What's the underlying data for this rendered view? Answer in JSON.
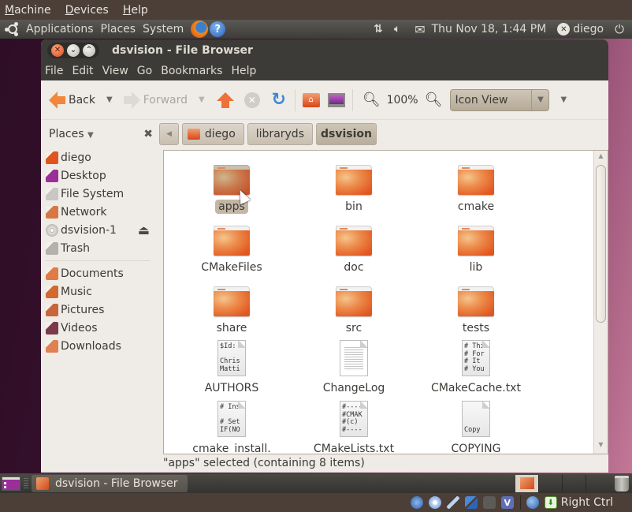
{
  "vbox_menu": {
    "items": [
      {
        "label": "Machine",
        "underline": "M",
        "rest": "achine"
      },
      {
        "label": "Devices",
        "underline": "D",
        "rest": "evices"
      },
      {
        "label": "Help",
        "underline": "H",
        "rest": "elp"
      }
    ]
  },
  "top_panel": {
    "menus": [
      "Applications",
      "Places",
      "System"
    ],
    "clock": "Thu Nov 18,  1:44 PM",
    "user": "diego"
  },
  "window": {
    "title": "dsvision - File Browser",
    "menubar": [
      "File",
      "Edit",
      "View",
      "Go",
      "Bookmarks",
      "Help"
    ],
    "toolbar": {
      "back_label": "Back",
      "forward_label": "Forward",
      "zoom_level": "100%",
      "view_mode": "Icon View"
    },
    "sidebar_header": "Places",
    "path": [
      "diego",
      "libraryds",
      "dsvision"
    ],
    "sidebar": {
      "devices": [
        {
          "label": "diego",
          "icon": "home-folder-icon",
          "color": "#e0541e"
        },
        {
          "label": "Desktop",
          "icon": "desktop-icon",
          "color": "#9a2f9a"
        },
        {
          "label": "File System",
          "icon": "harddisk-icon",
          "color": "#c9c7c2"
        },
        {
          "label": "Network",
          "icon": "network-folder-icon",
          "color": "#d97744"
        },
        {
          "label": "dsvision-1",
          "icon": "cdrom-icon",
          "color": "#d8d6d2"
        },
        {
          "label": "Trash",
          "icon": "trash-icon",
          "color": "#b3b1ac"
        }
      ],
      "bookmarks": [
        {
          "label": "Documents",
          "icon": "documents-folder-icon",
          "color": "#e07b45"
        },
        {
          "label": "Music",
          "icon": "music-folder-icon",
          "color": "#d2692f"
        },
        {
          "label": "Pictures",
          "icon": "pictures-folder-icon",
          "color": "#c9653a"
        },
        {
          "label": "Videos",
          "icon": "videos-folder-icon",
          "color": "#7a3a4a"
        },
        {
          "label": "Downloads",
          "icon": "downloads-folder-icon",
          "color": "#e08050"
        }
      ]
    },
    "files": [
      {
        "name": "apps",
        "type": "folder",
        "selected": true
      },
      {
        "name": "bin",
        "type": "folder"
      },
      {
        "name": "cmake",
        "type": "folder"
      },
      {
        "name": "CMakeFiles",
        "type": "folder"
      },
      {
        "name": "doc",
        "type": "folder"
      },
      {
        "name": "lib",
        "type": "folder"
      },
      {
        "name": "share",
        "type": "folder"
      },
      {
        "name": "src",
        "type": "folder"
      },
      {
        "name": "tests",
        "type": "folder"
      },
      {
        "name": "AUTHORS",
        "type": "text",
        "preview": [
          "$Id:",
          "",
          "Chris",
          "Matti"
        ]
      },
      {
        "name": "ChangeLog",
        "type": "text-lines"
      },
      {
        "name": "CMakeCache.txt",
        "type": "text",
        "preview": [
          "# Thi",
          "# For",
          "# It",
          "# You"
        ]
      },
      {
        "name": "cmake_install.",
        "type": "text",
        "preview": [
          "# Ins",
          "",
          "# Set",
          "IF(NO"
        ]
      },
      {
        "name": "CMakeLists.txt",
        "type": "text",
        "preview": [
          "#----",
          "#CMAK",
          "#(c)",
          "#----"
        ]
      },
      {
        "name": "COPYING",
        "type": "text",
        "preview": [
          "",
          "",
          "",
          "Copy"
        ]
      }
    ],
    "status": "\"apps\" selected (containing 8 items)"
  },
  "bottom_panel": {
    "task_label": "dsvision - File Browser"
  },
  "vbox_status": {
    "host_key": "Right Ctrl"
  }
}
